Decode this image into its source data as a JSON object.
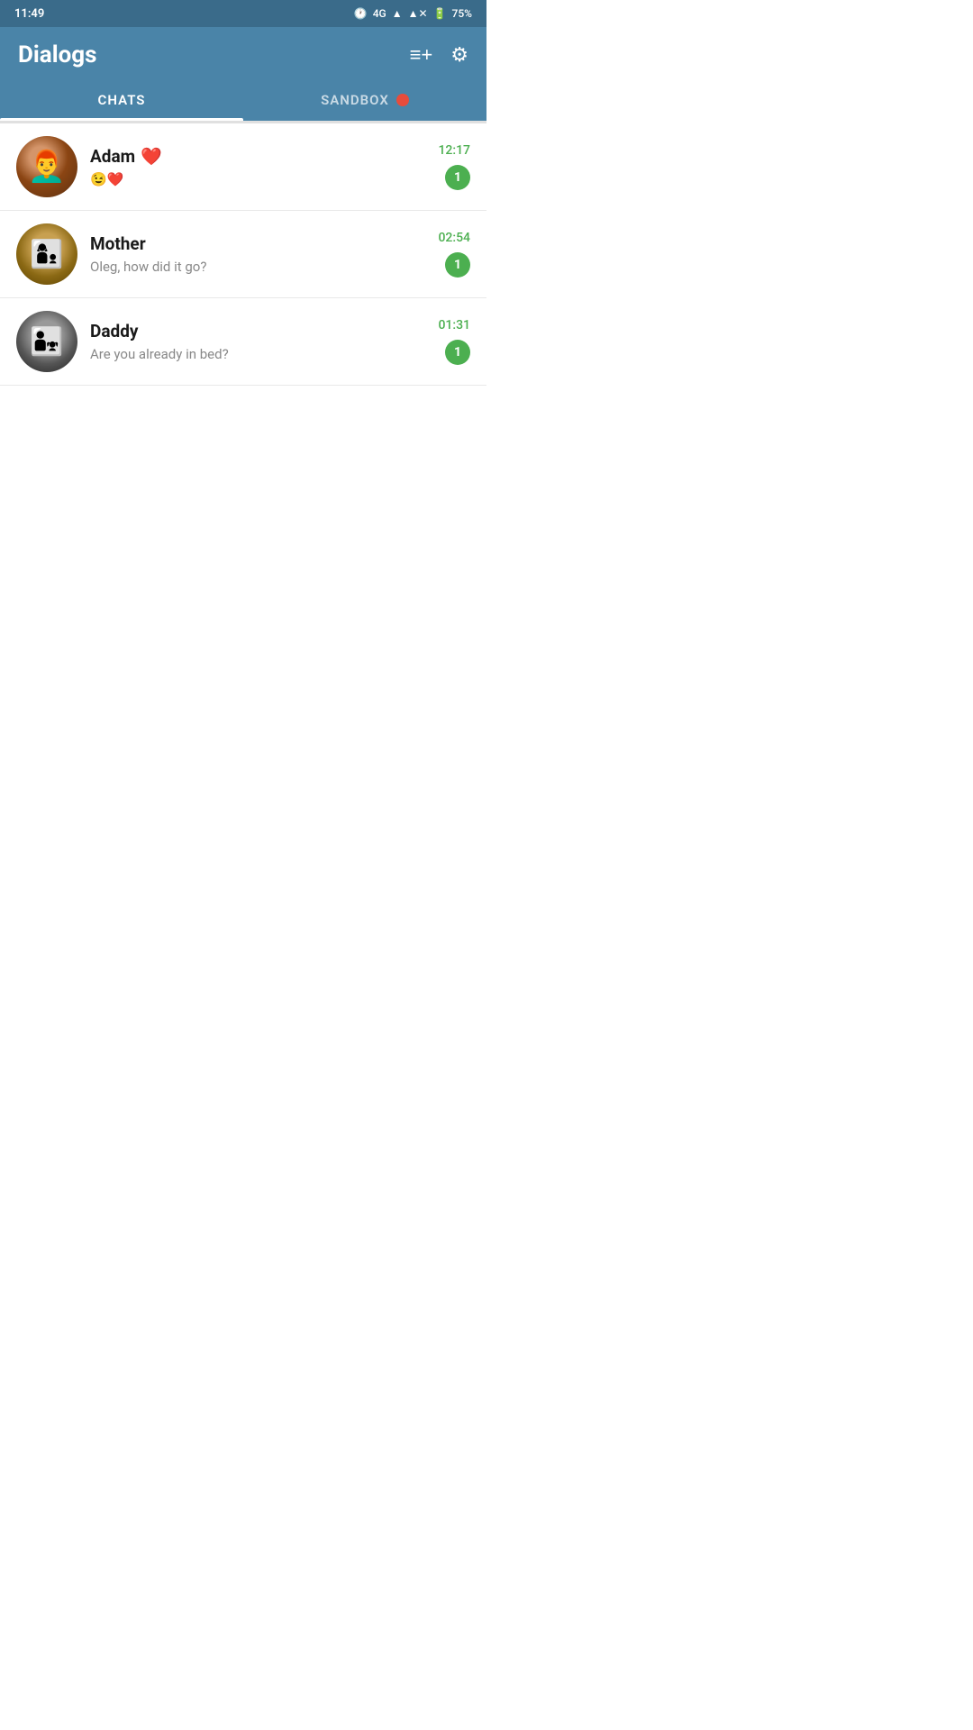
{
  "statusBar": {
    "time": "11:49",
    "network": "4G",
    "battery": "75%"
  },
  "header": {
    "title": "Dialogs",
    "newChatIcon": "≡+",
    "settingsIcon": "⚙"
  },
  "tabs": [
    {
      "id": "chats",
      "label": "CHATS",
      "active": true
    },
    {
      "id": "sandbox",
      "label": "SANDBOX",
      "active": false,
      "hasDot": true
    }
  ],
  "chats": [
    {
      "id": "adam",
      "name": "Adam",
      "nameEmoji": "❤️",
      "preview": "😉❤️",
      "time": "12:17",
      "unread": "1"
    },
    {
      "id": "mother",
      "name": "Mother",
      "preview": "Oleg, how did it go?",
      "time": "02:54",
      "unread": "1"
    },
    {
      "id": "daddy",
      "name": "Daddy",
      "preview": "Are you already in bed?",
      "time": "01:31",
      "unread": "1"
    }
  ]
}
